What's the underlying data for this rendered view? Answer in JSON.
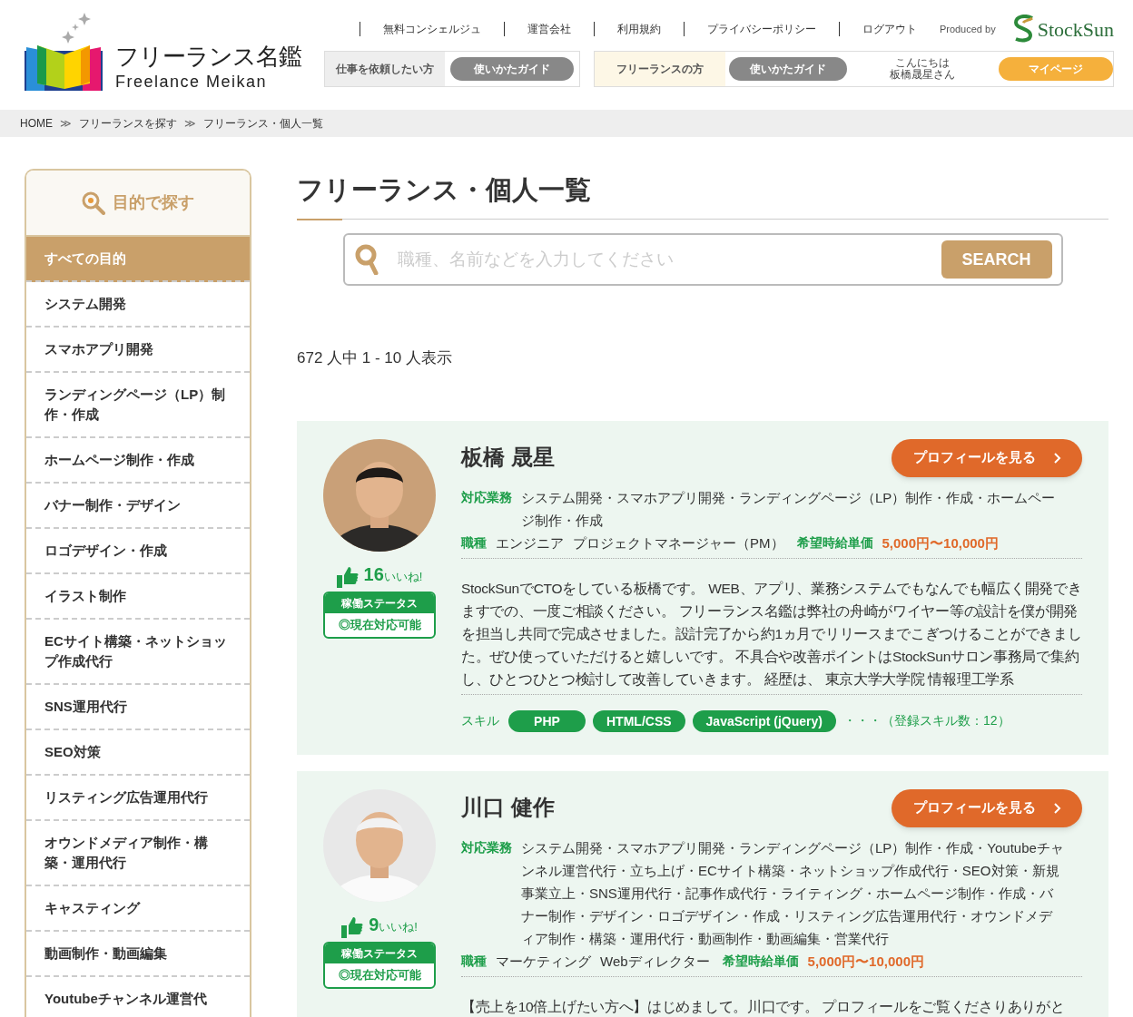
{
  "header": {
    "logo": {
      "title": "フリーランス名鑑",
      "subtitle": "Freelance Meikan"
    },
    "nav_links": [
      "無料コンシェルジュ",
      "運営会社",
      "利用規約",
      "プライバシーポリシー",
      "ログアウト"
    ],
    "produced_by": "Produced by",
    "brand": "StockSun",
    "client_box": {
      "label": "仕事を依頼したい方",
      "guide": "使いかたガイド"
    },
    "freelancer_box": {
      "label": "フリーランスの方",
      "guide": "使いかたガイド",
      "greeting": [
        "こんにちは",
        "板橋晟星さん"
      ],
      "mypage": "マイページ"
    }
  },
  "breadcrumb": {
    "separator": "≫",
    "links": [
      "HOME",
      "フリーランスを探す",
      "フリーランス・個人一覧"
    ]
  },
  "sidebar": {
    "heading": "目的で探す",
    "items": [
      {
        "label": "すべての目的",
        "selected": true
      },
      {
        "label": "システム開発",
        "selected": false
      },
      {
        "label": "スマホアプリ開発",
        "selected": false
      },
      {
        "label": "ランディングページ（LP）制作・作成",
        "selected": false
      },
      {
        "label": "ホームページ制作・作成",
        "selected": false
      },
      {
        "label": "バナー制作・デザイン",
        "selected": false
      },
      {
        "label": "ロゴデザイン・作成",
        "selected": false
      },
      {
        "label": "イラスト制作",
        "selected": false
      },
      {
        "label": "ECサイト構築・ネットショップ作成代行",
        "selected": false
      },
      {
        "label": "SNS運用代行",
        "selected": false
      },
      {
        "label": "SEO対策",
        "selected": false
      },
      {
        "label": "リスティング広告運用代行",
        "selected": false
      },
      {
        "label": "オウンドメディア制作・構築・運用代行",
        "selected": false
      },
      {
        "label": "キャスティング",
        "selected": false
      },
      {
        "label": "動画制作・動画編集",
        "selected": false
      },
      {
        "label": "Youtubeチャンネル運営代",
        "selected": false
      }
    ]
  },
  "main": {
    "title": "フリーランス・個人一覧",
    "search": {
      "placeholder": "職種、名前などを入力してください",
      "button": "SEARCH"
    },
    "result_count": "672 人中 1 - 10 人表示",
    "freelancers": [
      {
        "name": "板橋 晟星",
        "likes": "16",
        "likes_unit": "いいね!",
        "status_label": "稼働ステータス",
        "status": "◎現在対応可能",
        "profile_button": "プロフィールを見る",
        "services_label": "対応業務",
        "services": "システム開発・スマホアプリ開発・ランディングページ（LP）制作・作成・ホームページ制作・作成",
        "job_label": "職種",
        "jobs": [
          "エンジニア",
          "プロジェクトマネージャー（PM）"
        ],
        "rate_label": "希望時給単価",
        "rate": "5,000円〜10,000円",
        "bio": "StockSunでCTOをしている板橋です。 WEB、アプリ、業務システムでもなんでも幅広く開発できますでの、一度ご相談ください。 フリーランス名鑑は弊社の舟崎がワイヤー等の設計を僕が開発を担当し共同で完成させました。設計完了から約1ヵ月でリリースまでこぎつけることができました。ぜひ使っていただけると嬉しいです。 不具合や改善ポイントはStockSunサロン事務局で集約し、ひとつひとつ検討して改善していきます。 経歴は、 東京大学大学院 情報理工学系",
        "skills_label": "スキル",
        "skills": [
          "PHP",
          "HTML/CSS",
          "JavaScript (jQuery)"
        ],
        "skills_more": "・・・（登録スキル数：12）"
      },
      {
        "name": "川口 健作",
        "likes": "9",
        "likes_unit": "いいね!",
        "status_label": "稼働ステータス",
        "status": "◎現在対応可能",
        "profile_button": "プロフィールを見る",
        "services_label": "対応業務",
        "services": "システム開発・スマホアプリ開発・ランディングページ（LP）制作・作成・Youtubeチャンネル運営代行・立ち上げ・ECサイト構築・ネットショップ作成代行・SEO対策・新規事業立上・SNS運用代行・記事作成代行・ライティング・ホームページ制作・作成・バナー制作・デザイン・ロゴデザイン・作成・リスティング広告運用代行・オウンドメディア制作・構築・運用代行・動画制作・動画編集・営業代行",
        "job_label": "職種",
        "jobs": [
          "マーケティング",
          "Webディレクター"
        ],
        "rate_label": "希望時給単価",
        "rate": "5,000円〜10,000円",
        "bio": "【売上を10倍上げたい方へ】はじめまして。川口です。 プロフィールをご覧くださりありがと"
      }
    ]
  }
}
